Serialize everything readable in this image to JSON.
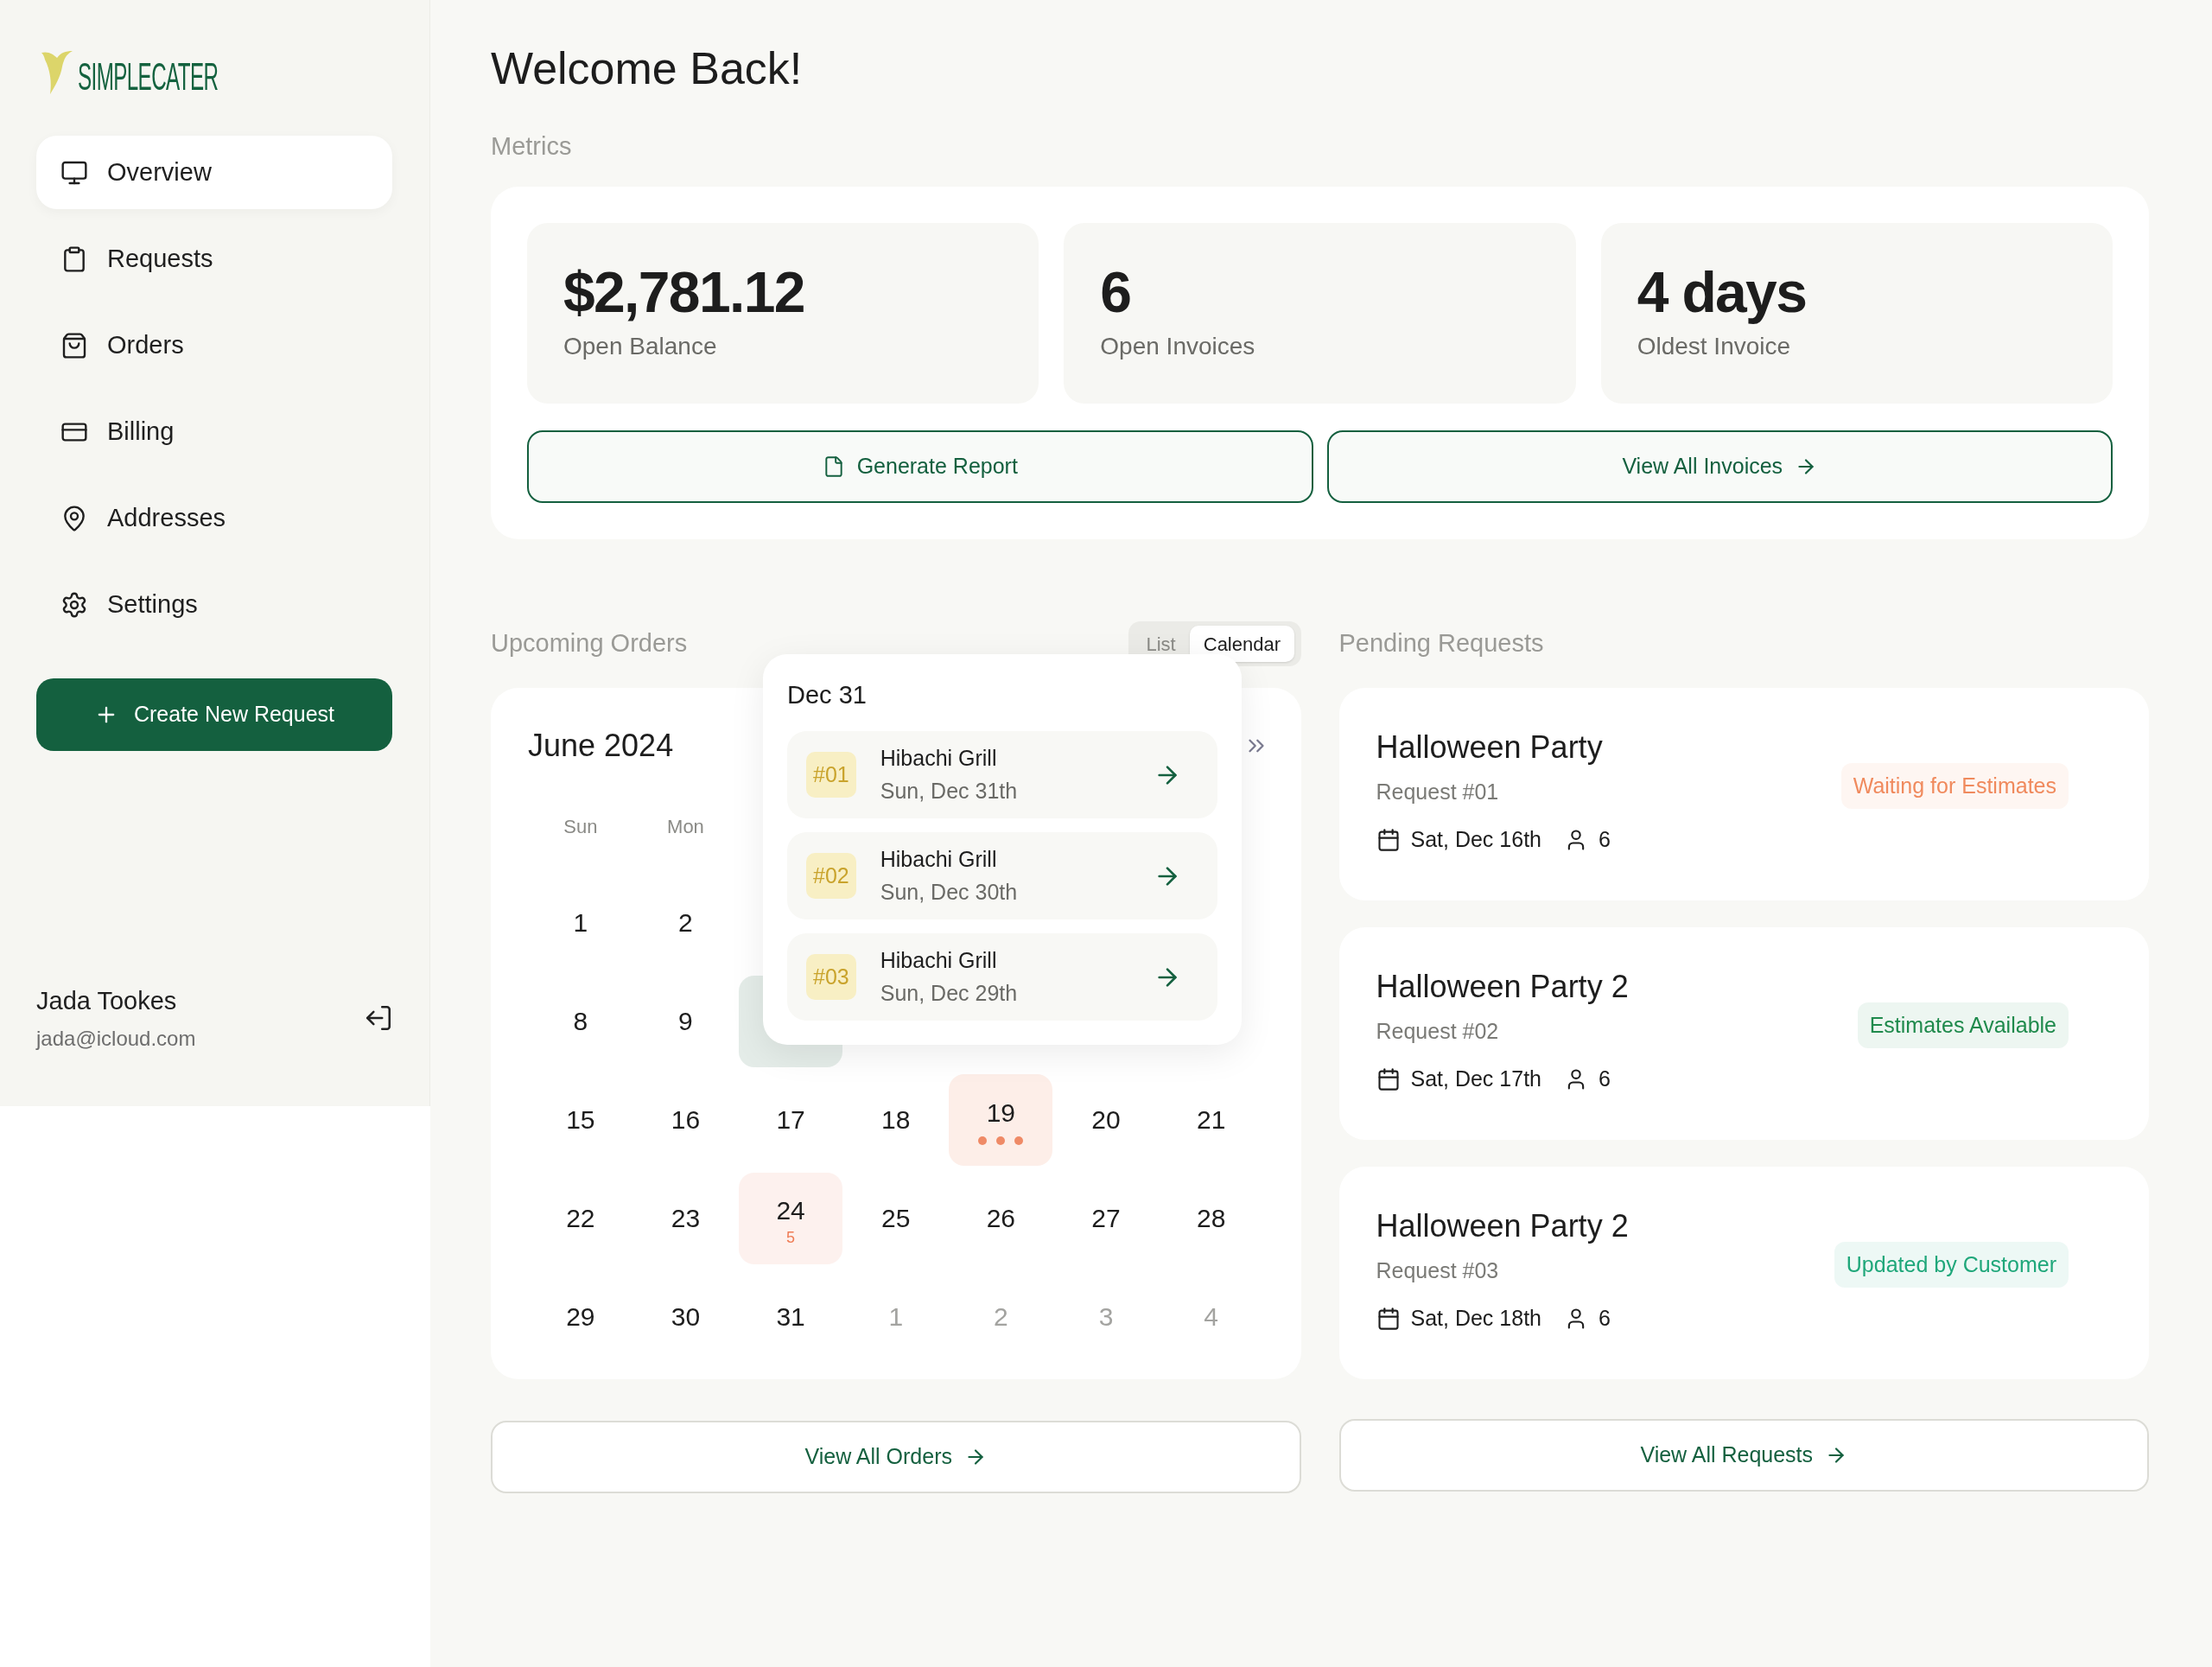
{
  "logo": {
    "text": "SIMPLECATER"
  },
  "nav": [
    {
      "label": "Overview",
      "selected": true
    },
    {
      "label": "Requests",
      "selected": false
    },
    {
      "label": "Orders",
      "selected": false
    },
    {
      "label": "Billing",
      "selected": false
    },
    {
      "label": "Addresses",
      "selected": false
    },
    {
      "label": "Settings",
      "selected": false
    }
  ],
  "create_button": "Create New Request",
  "user": {
    "name": "Jada Tookes",
    "email": "jada@icloud.com"
  },
  "title": "Welcome Back!",
  "metrics": {
    "label": "Metrics",
    "stats": [
      {
        "value": "$2,781.12",
        "label": "Open Balance"
      },
      {
        "value": "6",
        "label": "Open Invoices"
      },
      {
        "value": "4 days",
        "label": "Oldest Invoice"
      }
    ],
    "buttons": [
      {
        "label": "Generate Report",
        "kind": "report"
      },
      {
        "label": "View All Invoices",
        "kind": "link"
      }
    ]
  },
  "upcoming_orders": {
    "label": "Upcoming Orders",
    "view_toggle": [
      {
        "label": "List",
        "selected": false
      },
      {
        "label": "Calendar",
        "selected": true
      }
    ],
    "calendar": {
      "month": "June 2024",
      "weekdays": [
        "Sun",
        "Mon"
      ],
      "weeks": [
        [
          {
            "kind": "day",
            "label": "1"
          },
          {
            "kind": "day",
            "label": "2"
          },
          {
            "kind": "covered"
          },
          {
            "kind": "covered"
          },
          {
            "kind": "covered"
          },
          {
            "kind": "covered"
          },
          {
            "kind": "covered"
          }
        ],
        [
          {
            "kind": "day",
            "label": "8"
          },
          {
            "kind": "day",
            "label": "9"
          },
          {
            "kind": "selected"
          },
          {
            "kind": "covered"
          },
          {
            "kind": "covered"
          },
          {
            "kind": "covered"
          },
          {
            "kind": "covered"
          }
        ],
        [
          {
            "kind": "day",
            "label": "15"
          },
          {
            "kind": "day",
            "label": "16"
          },
          {
            "kind": "day",
            "label": "17"
          },
          {
            "kind": "day",
            "label": "18"
          },
          {
            "kind": "events",
            "label": "19"
          },
          {
            "kind": "day",
            "label": "20"
          },
          {
            "kind": "day",
            "label": "21"
          }
        ],
        [
          {
            "kind": "day",
            "label": "22"
          },
          {
            "kind": "day",
            "label": "23"
          },
          {
            "kind": "count",
            "label": "24",
            "count": "5"
          },
          {
            "kind": "day",
            "label": "25"
          },
          {
            "kind": "day",
            "label": "26"
          },
          {
            "kind": "day",
            "label": "27"
          },
          {
            "kind": "day",
            "label": "28"
          }
        ],
        [
          {
            "kind": "day",
            "label": "29"
          },
          {
            "kind": "day",
            "label": "30"
          },
          {
            "kind": "day",
            "label": "31"
          },
          {
            "kind": "day",
            "label": "1",
            "muted": true
          },
          {
            "kind": "day",
            "label": "2",
            "muted": true
          },
          {
            "kind": "day",
            "label": "3",
            "muted": true
          },
          {
            "kind": "day",
            "label": "4",
            "muted": true
          }
        ]
      ]
    },
    "popup": {
      "title": "Dec 31",
      "orders": [
        {
          "number": "#01",
          "name": "Hibachi Grill",
          "date": "Sun, Dec 31th"
        },
        {
          "number": "#02",
          "name": "Hibachi Grill",
          "date": "Sun, Dec 30th"
        },
        {
          "number": "#03",
          "name": "Hibachi Grill",
          "date": "Sun, Dec 29th"
        }
      ]
    },
    "view_all": "View All Orders"
  },
  "pending_requests": {
    "label": "Pending Requests",
    "requests": [
      {
        "title": "Halloween Party",
        "number": "Request #01",
        "status": "Waiting for Estimates",
        "color": "#f08a5d",
        "date": "Sat, Dec 16th",
        "guests": "6"
      },
      {
        "title": "Halloween Party 2",
        "number": "Request #02",
        "status": "Estimates Available",
        "color": "#1f8a4c",
        "date": "Sat, Dec 17th",
        "guests": "6"
      },
      {
        "title": "Halloween Party 2",
        "number": "Request #03",
        "status": "Updated by Customer",
        "color": "#1fa77a",
        "date": "Sat, Dec 18th",
        "guests": "6"
      }
    ],
    "view_all": "View All Requests"
  }
}
